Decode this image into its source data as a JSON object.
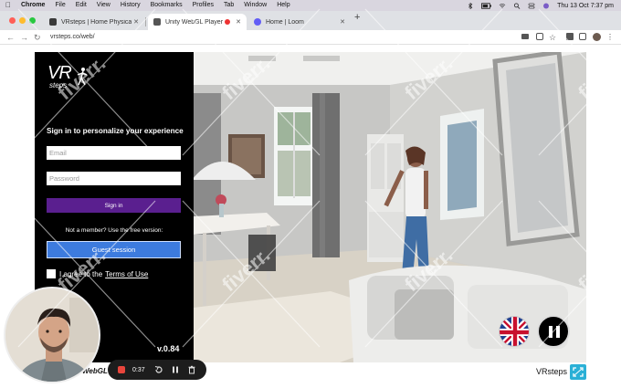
{
  "menubar": {
    "app": "Chrome",
    "items": [
      "File",
      "Edit",
      "View",
      "History",
      "Bookmarks",
      "Profiles",
      "Tab",
      "Window",
      "Help"
    ],
    "datetime": "Thu 13 Oct  7:37 pm"
  },
  "tabs": [
    {
      "title": "VRsteps | Home Physical Reha",
      "favicon_color": "#3a3a3a",
      "active": false
    },
    {
      "title": "Unity WebGL Player | VRste",
      "favicon_color": "#555555",
      "active": true,
      "recording": true
    },
    {
      "title": "Home | Loom",
      "favicon_color": "#625df5",
      "active": false
    }
  ],
  "address_bar": {
    "url": "vrsteps.co/web/"
  },
  "signin": {
    "logo_vr": "VR",
    "logo_steps": "steps",
    "heading": "Sign in to personalize your experience",
    "email_placeholder": "Email",
    "password_placeholder": "Password",
    "signin_label": "Sign in",
    "not_member_text": "Not a member? Use the free version:",
    "guest_label": "Guest session",
    "agree_text": "I agree to the",
    "terms_label": "Terms of Use",
    "version": "v.0.84"
  },
  "footer": {
    "webgl_label": "WebGL",
    "brand": "VRsteps"
  },
  "loom": {
    "elapsed": "0:37"
  },
  "watermark_text": "fiverr.",
  "colors": {
    "signin_button": "#5a1f8f",
    "guest_button": "#3d7bde",
    "fullscreen_button": "#2ab0d6",
    "loom_stop": "#e8453c"
  }
}
